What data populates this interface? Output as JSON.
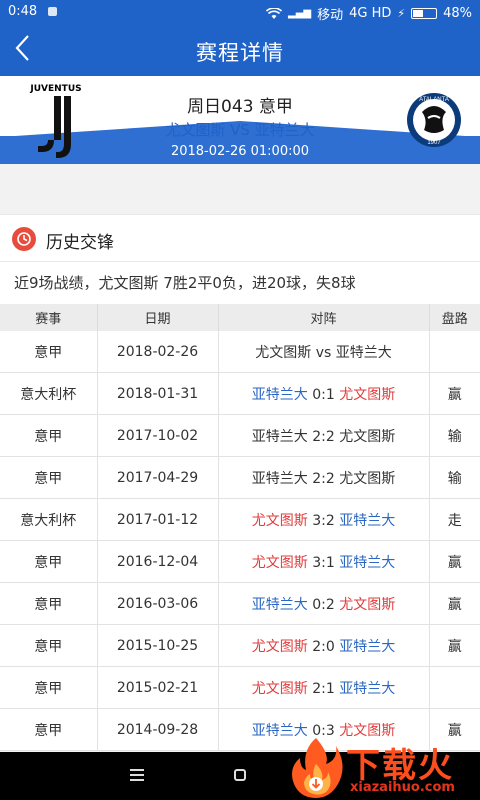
{
  "status": {
    "time": "0:48",
    "carrier": "移动",
    "network": "4G HD",
    "battery": "48%",
    "battery_level": 0.48
  },
  "header": {
    "title": "赛程详情"
  },
  "match": {
    "league": "周日043 意甲",
    "teams": "尤文图斯 VS 亚特兰大",
    "datetime": "2018-02-26 01:00:00",
    "home_logo_text": "JUVENTUS",
    "away_logo_text_top": "ATALANTA",
    "away_logo_text_bottom": "1907"
  },
  "section": {
    "title": "历史交锋"
  },
  "summary": "近9场战绩，尤文图斯 7胜2平0负，进20球，失8球",
  "table": {
    "headers": [
      "赛事",
      "日期",
      "对阵",
      "盘路"
    ],
    "rows": [
      {
        "league": "意甲",
        "date": "2018-02-26",
        "home": "尤文图斯",
        "score": "vs",
        "away": "亚特兰大",
        "home_color": "black",
        "away_color": "black",
        "result": "",
        "result_color": "red"
      },
      {
        "league": "意大利杯",
        "date": "2018-01-31",
        "home": "亚特兰大",
        "score": "0:1",
        "away": "尤文图斯",
        "home_color": "blue",
        "away_color": "red",
        "result": "赢",
        "result_color": "red"
      },
      {
        "league": "意甲",
        "date": "2017-10-02",
        "home": "亚特兰大",
        "score": "2:2",
        "away": "尤文图斯",
        "home_color": "black",
        "away_color": "black",
        "result": "输",
        "result_color": "blue"
      },
      {
        "league": "意甲",
        "date": "2017-04-29",
        "home": "亚特兰大",
        "score": "2:2",
        "away": "尤文图斯",
        "home_color": "black",
        "away_color": "black",
        "result": "输",
        "result_color": "blue"
      },
      {
        "league": "意大利杯",
        "date": "2017-01-12",
        "home": "尤文图斯",
        "score": "3:2",
        "away": "亚特兰大",
        "home_color": "red",
        "away_color": "blue",
        "result": "走",
        "result_color": "black"
      },
      {
        "league": "意甲",
        "date": "2016-12-04",
        "home": "尤文图斯",
        "score": "3:1",
        "away": "亚特兰大",
        "home_color": "red",
        "away_color": "blue",
        "result": "赢",
        "result_color": "red"
      },
      {
        "league": "意甲",
        "date": "2016-03-06",
        "home": "亚特兰大",
        "score": "0:2",
        "away": "尤文图斯",
        "home_color": "blue",
        "away_color": "red",
        "result": "赢",
        "result_color": "red"
      },
      {
        "league": "意甲",
        "date": "2015-10-25",
        "home": "尤文图斯",
        "score": "2:0",
        "away": "亚特兰大",
        "home_color": "red",
        "away_color": "blue",
        "result": "赢",
        "result_color": "red"
      },
      {
        "league": "意甲",
        "date": "2015-02-21",
        "home": "尤文图斯",
        "score": "2:1",
        "away": "亚特兰大",
        "home_color": "red",
        "away_color": "blue",
        "result": "",
        "result_color": "red"
      },
      {
        "league": "意甲",
        "date": "2014-09-28",
        "home": "亚特兰大",
        "score": "0:3",
        "away": "尤文图斯",
        "home_color": "blue",
        "away_color": "red",
        "result": "赢",
        "result_color": "red"
      }
    ]
  },
  "watermark": {
    "title": "下载火",
    "url": "xiazaihuo.com"
  },
  "colors": {
    "primary": "#1f63c9",
    "win": "#e03b3b",
    "lose": "#2a66c2"
  }
}
